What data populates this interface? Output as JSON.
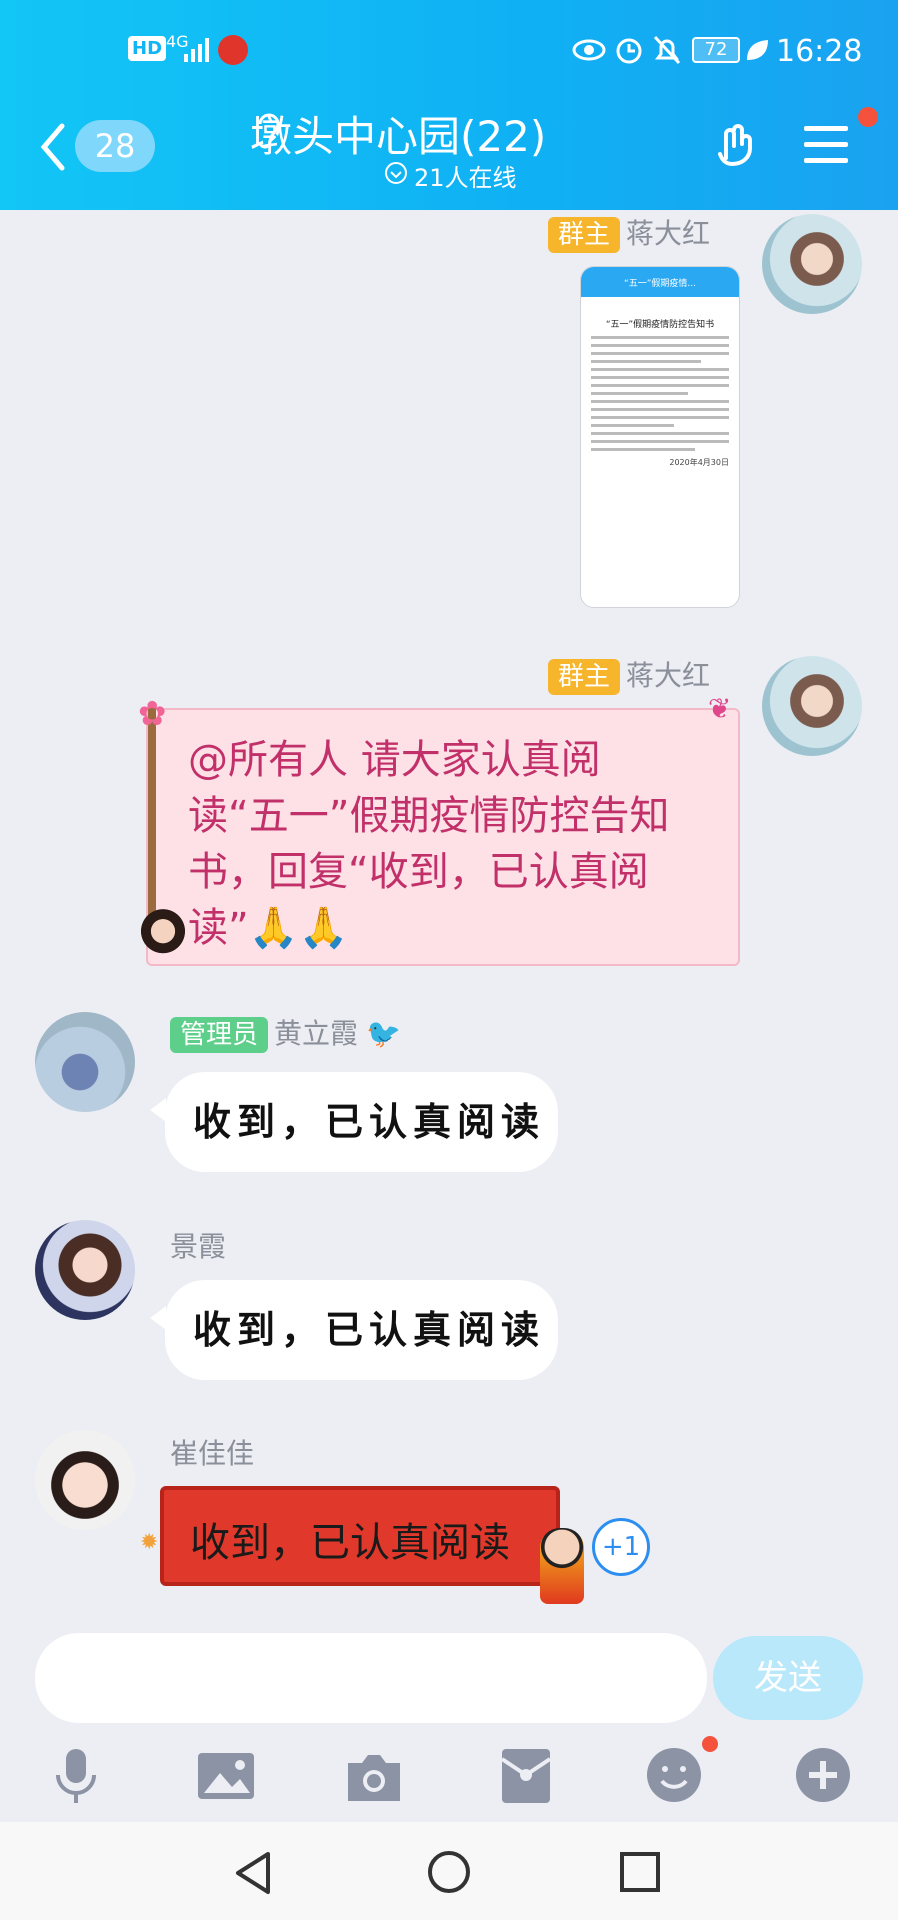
{
  "status_bar": {
    "hd": "HD",
    "network": "4G",
    "battery": "72",
    "time": "16:28"
  },
  "header": {
    "back_count": "28",
    "title": "墩头中心园(22)",
    "online": "21人在线"
  },
  "messages": [
    {
      "role_tag": "群主",
      "sender": "蒋大红",
      "type": "image",
      "image_title": "“五一”假期疫情防控告知书",
      "image_tab": "“五一”假期疫情...",
      "image_date": "2020年4月30日"
    },
    {
      "role_tag": "群主",
      "sender": "蒋大红",
      "type": "text",
      "text": "@所有人 请大家认真阅读“五一”假期疫情防控告知书，回复“收到，已认真阅读”🙏🙏"
    },
    {
      "role_tag": "管理员",
      "sender": "黄立霞",
      "type": "text",
      "text": "收到，已认真阅读"
    },
    {
      "sender": "景霞",
      "type": "text",
      "text": "收到，已认真阅读"
    },
    {
      "sender": "崔佳佳",
      "type": "text",
      "text": "收到，已认真阅读",
      "plus": "+1"
    }
  ],
  "composer": {
    "placeholder": "",
    "send_label": "发送"
  },
  "toolbar": [
    "mic-icon",
    "image-icon",
    "camera-icon",
    "red-packet-icon",
    "emoji-icon",
    "plus-icon"
  ],
  "colors": {
    "header": "#10b0f4",
    "owner_tag": "#f6b52a",
    "admin_tag": "#5dcf8a",
    "announcement_text": "#c2306a",
    "red_bubble": "#e0392b",
    "background": "#eceef4"
  }
}
